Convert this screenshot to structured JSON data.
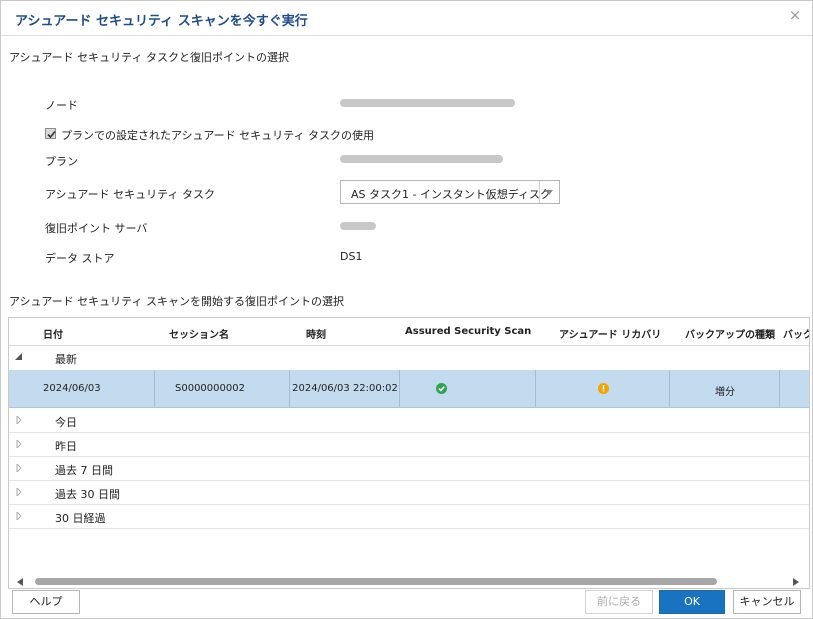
{
  "dialog": {
    "title": "アシュアード セキュリティ スキャンを今すぐ実行",
    "close_glyph": "×"
  },
  "task_section": {
    "heading": "アシュアード セキュリティ タスクと復旧ポイントの選択",
    "node_label": "ノード",
    "use_plan_checkbox_label": "プランでの設定されたアシュアード セキュリティ タスクの使用",
    "use_plan_checked": true,
    "plan_label": "プラン",
    "task_label": "アシュアード セキュリティ タスク",
    "task_value": "AS タスク1 - インスタント仮想ディスク",
    "rps_label": "復旧ポイント サーバ",
    "datastore_label": "データ ストア",
    "datastore_value": "DS1"
  },
  "recovery_section": {
    "heading": "アシュアード セキュリティ スキャンを開始する復旧ポイントの選択",
    "columns": [
      "日付",
      "セッション名",
      "時刻",
      "Assured Security Scan",
      "アシュアード リカバリ",
      "バックアップの種類",
      "バック"
    ],
    "latest_group": "最新",
    "row": {
      "date": "2024/06/03",
      "session": "S0000000002",
      "time": "2024/06/03 22:00:02",
      "scan_status_icon": "success-check-icon",
      "recovery_status_icon": "warning-icon",
      "backup_type": "増分"
    },
    "groups": [
      "今日",
      "昨日",
      "過去 7 日間",
      "過去 30 日間",
      "30 日経過"
    ]
  },
  "footer": {
    "help_label": "ヘルプ",
    "back_label": "前に戻る",
    "ok_label": "OK",
    "cancel_label": "キャンセル"
  },
  "colors": {
    "title": "#1f4d8c",
    "selected_row": "#c3dbee",
    "primary_button": "#1a73c0",
    "success": "#2ea44f",
    "warning": "#f0a500"
  }
}
